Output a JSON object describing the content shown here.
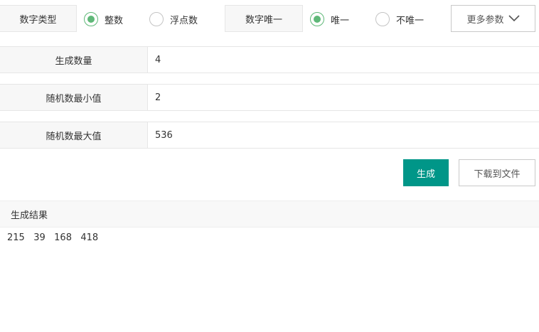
{
  "options": {
    "number_type": {
      "label": "数字类型",
      "choices": [
        {
          "label": "整数",
          "checked": true
        },
        {
          "label": "浮点数",
          "checked": false
        }
      ]
    },
    "number_unique": {
      "label": "数字唯一",
      "choices": [
        {
          "label": "唯一",
          "checked": true
        },
        {
          "label": "不唯一",
          "checked": false
        }
      ]
    },
    "more_params_label": "更多参数"
  },
  "form": {
    "count": {
      "label": "生成数量",
      "value": "4"
    },
    "min": {
      "label": "随机数最小值",
      "value": "2"
    },
    "max": {
      "label": "随机数最大值",
      "value": "536"
    }
  },
  "actions": {
    "generate_label": "生成",
    "download_label": "下载到文件"
  },
  "result": {
    "title": "生成结果",
    "values_text": "215   39   168   418"
  },
  "colors": {
    "primary": "#009688",
    "radio_checked": "#5fb878",
    "label_bg": "#f7f7f7",
    "border": "#e6e6e6"
  }
}
